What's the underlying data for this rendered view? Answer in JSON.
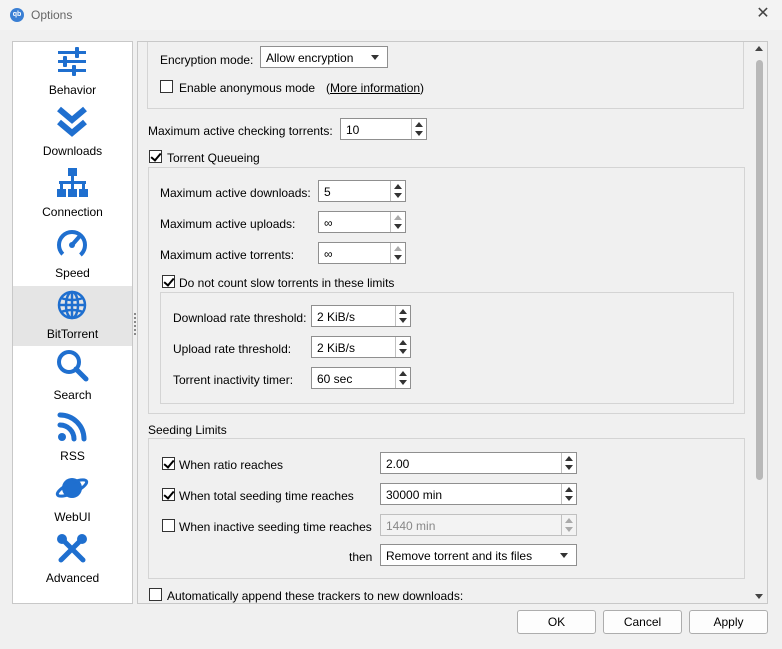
{
  "window": {
    "title": "Options",
    "app_icon": "qb",
    "close_glyph": "✕"
  },
  "sidebar": {
    "items": [
      {
        "label": "Behavior",
        "icon": "sliders-icon"
      },
      {
        "label": "Downloads",
        "icon": "double-chevron-down-icon"
      },
      {
        "label": "Connection",
        "icon": "network-icon"
      },
      {
        "label": "Speed",
        "icon": "speedometer-icon"
      },
      {
        "label": "BitTorrent",
        "icon": "globe-icon"
      },
      {
        "label": "Search",
        "icon": "search-icon"
      },
      {
        "label": "RSS",
        "icon": "rss-icon"
      },
      {
        "label": "WebUI",
        "icon": "planet-icon"
      },
      {
        "label": "Advanced",
        "icon": "tools-icon"
      }
    ],
    "selected": "BitTorrent",
    "accent_color": "#1f6fcf"
  },
  "privacy": {
    "encryption_label": "Encryption mode:",
    "encryption_value": "Allow encryption",
    "anonymous_label": "Enable anonymous mode",
    "anonymous_checked": false,
    "more_info_open": "(",
    "more_info_link": "More information",
    "more_info_close": ")"
  },
  "checking": {
    "label": "Maximum active checking torrents:",
    "value": "10"
  },
  "queueing": {
    "label": "Torrent Queueing",
    "checked": true,
    "max_downloads_label": "Maximum active downloads:",
    "max_downloads_value": "5",
    "max_uploads_label": "Maximum active uploads:",
    "max_uploads_value": "∞",
    "max_torrents_label": "Maximum active torrents:",
    "max_torrents_value": "∞",
    "slow_label": "Do not count slow torrents in these limits",
    "slow_checked": true,
    "dl_threshold_label": "Download rate threshold:",
    "dl_threshold_value": "2 KiB/s",
    "ul_threshold_label": "Upload rate threshold:",
    "ul_threshold_value": "2 KiB/s",
    "inactivity_label": "Torrent inactivity timer:",
    "inactivity_value": "60 sec"
  },
  "seeding": {
    "title": "Seeding Limits",
    "ratio_label": "When ratio reaches",
    "ratio_checked": true,
    "ratio_value": "2.00",
    "time_label": "When total seeding time reaches",
    "time_checked": true,
    "time_value": "30000 min",
    "inactive_label": "When inactive seeding time reaches",
    "inactive_checked": false,
    "inactive_value": "1440 min",
    "then_label": "then",
    "action_value": "Remove torrent and its files"
  },
  "trackers": {
    "label": "Automatically append these trackers to new downloads:",
    "checked": false
  },
  "buttons": {
    "ok": "OK",
    "cancel": "Cancel",
    "apply": "Apply"
  }
}
